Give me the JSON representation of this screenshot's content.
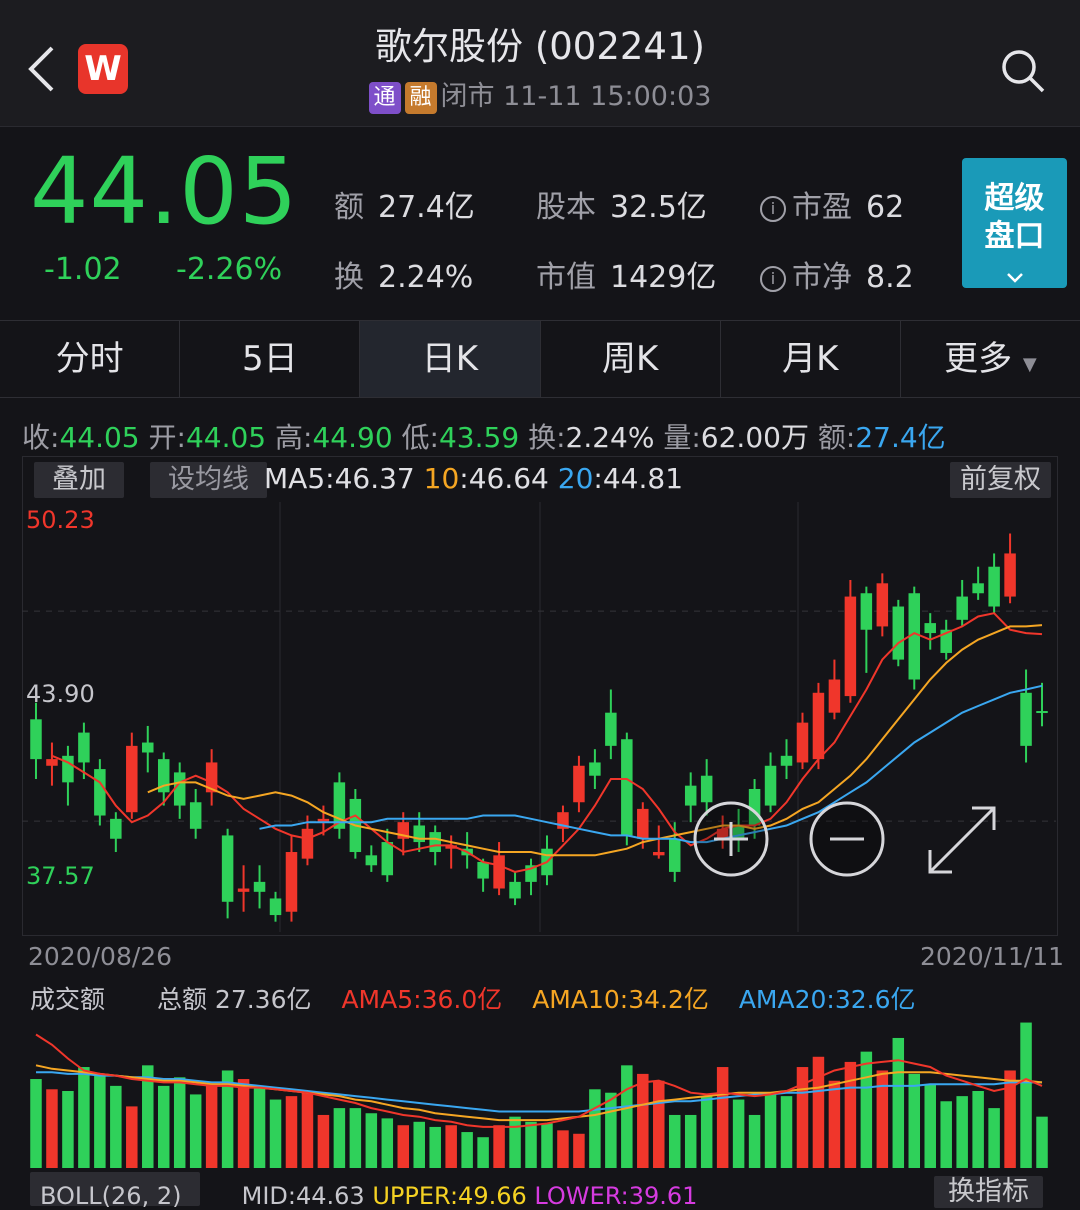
{
  "header": {
    "title": "歌尔股份 (002241)",
    "tag_tong": "通",
    "tag_rong": "融",
    "status": "闭市 11-11 15:00:03",
    "logo_letter": "W"
  },
  "quote": {
    "price": "44.05",
    "change": "-1.02",
    "change_pct": "-2.26%",
    "stats": [
      {
        "k": "额",
        "v": "27.4亿"
      },
      {
        "k": "股本",
        "v": "32.5亿"
      },
      {
        "k": "市盈",
        "v": "62"
      },
      {
        "k": "换",
        "v": "2.24%"
      },
      {
        "k": "市值",
        "v": "1429亿"
      },
      {
        "k": "市净",
        "v": "8.2"
      }
    ],
    "super_btn": [
      "超级",
      "盘口"
    ]
  },
  "tabs": [
    "分时",
    "5日",
    "日K",
    "周K",
    "月K",
    "更多"
  ],
  "ohlc": {
    "close_k": "收:",
    "close": "44.05",
    "open_k": "开:",
    "open": "44.05",
    "high_k": "高:",
    "high": "44.90",
    "low_k": "低:",
    "low": "43.59",
    "turn_k": "换:",
    "turn": "2.24%",
    "vol_k": "量:",
    "vol": "62.00万",
    "amt_k": "额:",
    "amt": "27.4亿"
  },
  "chart_controls": {
    "overlay": "叠加",
    "set_ma": "设均线",
    "adjust": "前复权",
    "ma5_k": "MA5",
    "ma5": ":46.37",
    "ma10_k": "10",
    "ma10": ":46.64",
    "ma20_k": "20",
    "ma20": ":44.81"
  },
  "axis": {
    "y_top": "50.23",
    "y_mid": "43.90",
    "y_low": "37.57",
    "date_start": "2020/08/26",
    "date_end": "2020/11/11"
  },
  "volume": {
    "label": "成交额",
    "total": "总额 27.36亿",
    "ama5_k": "AMA5",
    "ama5": ":36.0亿",
    "ama10_k": "AMA10",
    "ama10": ":34.2亿",
    "ama20_k": "AMA20",
    "ama20": ":32.6亿"
  },
  "indicator": {
    "boll": "BOLL(26, 2)",
    "mid": "MID:44.63",
    "upper": "UPPER:49.66",
    "lower": "LOWER:39.61",
    "switch": "换指标"
  },
  "colors": {
    "up": "#f0362b",
    "down": "#2fd15a",
    "ma5": "#f0362b",
    "ma10": "#f5a623",
    "ma20": "#3aa7f0",
    "accent": "#1a9ab8"
  },
  "chart_data": {
    "type": "candlestick",
    "xlim": [
      "2020/08/26",
      "2020/11/11"
    ],
    "ylim": [
      37.57,
      50.23
    ],
    "candles": [
      [
        43.8,
        42.6,
        44.3,
        42.0
      ],
      [
        42.4,
        42.6,
        43.1,
        41.8
      ],
      [
        42.7,
        41.9,
        43.0,
        41.2
      ],
      [
        43.4,
        42.5,
        43.7,
        42.0
      ],
      [
        42.3,
        40.9,
        42.6,
        40.6
      ],
      [
        40.8,
        40.2,
        41.0,
        39.8
      ],
      [
        41.0,
        43.0,
        43.4,
        40.8
      ],
      [
        43.1,
        42.8,
        43.6,
        42.2
      ],
      [
        42.6,
        41.6,
        42.8,
        41.2
      ],
      [
        42.2,
        41.2,
        42.5,
        40.8
      ],
      [
        41.3,
        40.5,
        41.7,
        40.2
      ],
      [
        41.6,
        42.5,
        42.9,
        41.2
      ],
      [
        40.3,
        38.3,
        40.5,
        37.8
      ],
      [
        38.6,
        38.7,
        39.4,
        38.0
      ],
      [
        38.9,
        38.6,
        39.4,
        38.1
      ],
      [
        38.4,
        37.9,
        38.6,
        37.7
      ],
      [
        38.0,
        39.8,
        40.3,
        37.7
      ],
      [
        39.6,
        40.5,
        40.9,
        39.4
      ],
      [
        40.7,
        40.8,
        41.2,
        40.3
      ],
      [
        41.9,
        40.5,
        42.2,
        40.2
      ],
      [
        41.4,
        39.8,
        41.7,
        39.6
      ],
      [
        39.7,
        39.4,
        40.0,
        39.2
      ],
      [
        40.1,
        39.1,
        40.5,
        38.9
      ],
      [
        40.2,
        40.7,
        41.0,
        39.7
      ],
      [
        40.6,
        40.1,
        41.0,
        39.8
      ],
      [
        40.4,
        39.8,
        40.6,
        39.4
      ],
      [
        39.9,
        40.0,
        40.3,
        39.3
      ],
      [
        39.9,
        39.7,
        40.4,
        39.3
      ],
      [
        39.5,
        39.0,
        39.6,
        38.6
      ],
      [
        38.7,
        39.7,
        40.1,
        38.5
      ],
      [
        38.9,
        38.4,
        39.2,
        38.2
      ],
      [
        39.4,
        38.9,
        39.6,
        38.5
      ],
      [
        39.9,
        39.1,
        40.3,
        38.8
      ],
      [
        40.5,
        41.0,
        41.2,
        40.1
      ],
      [
        41.3,
        42.4,
        42.7,
        41.0
      ],
      [
        42.5,
        42.1,
        42.9,
        41.7
      ],
      [
        44.0,
        43.0,
        44.7,
        42.6
      ],
      [
        43.2,
        40.3,
        43.4,
        40.0
      ],
      [
        40.2,
        41.1,
        41.3,
        39.9
      ],
      [
        39.7,
        39.8,
        40.6,
        39.6
      ],
      [
        40.2,
        39.2,
        40.7,
        38.9
      ],
      [
        41.8,
        41.2,
        42.2,
        40.7
      ],
      [
        42.1,
        41.3,
        42.6,
        40.9
      ],
      [
        40.2,
        40.5,
        40.9,
        39.9
      ],
      [
        40.6,
        40.2,
        41.1,
        39.8
      ],
      [
        41.7,
        40.6,
        42.0,
        40.2
      ],
      [
        42.4,
        41.2,
        42.8,
        41.0
      ],
      [
        42.7,
        42.4,
        43.2,
        42.0
      ],
      [
        42.5,
        43.7,
        44.0,
        42.3
      ],
      [
        42.6,
        44.6,
        44.9,
        42.3
      ],
      [
        44.0,
        45.0,
        45.6,
        43.8
      ],
      [
        44.5,
        47.5,
        48.0,
        44.3
      ],
      [
        47.6,
        46.5,
        47.8,
        45.2
      ],
      [
        46.6,
        47.9,
        48.2,
        46.3
      ],
      [
        47.2,
        45.6,
        47.4,
        45.4
      ],
      [
        47.6,
        45.0,
        47.8,
        44.7
      ],
      [
        46.7,
        46.4,
        47.0,
        45.9
      ],
      [
        46.5,
        45.8,
        46.8,
        45.6
      ],
      [
        47.5,
        46.8,
        48.0,
        46.6
      ],
      [
        47.9,
        47.6,
        48.4,
        47.4
      ],
      [
        48.4,
        47.2,
        48.8,
        47.0
      ],
      [
        47.5,
        48.8,
        49.4,
        47.3
      ],
      [
        44.6,
        43.0,
        45.3,
        42.5
      ],
      [
        44.05,
        44.05,
        44.9,
        43.59
      ]
    ],
    "ma5": [
      42.7,
      42.5,
      42.2,
      41.9,
      41.2,
      40.7,
      40.9,
      41.3,
      41.9,
      42.1,
      41.9,
      41.6,
      41.1,
      40.8,
      40.5,
      40.3,
      40.2,
      40.4,
      40.7,
      40.9,
      40.5,
      40.1,
      39.8,
      39.9,
      40.0,
      40.0,
      39.8,
      39.5,
      39.4,
      39.2,
      39.3,
      39.5,
      40.0,
      40.5,
      41.2,
      42.0,
      42.0,
      41.7,
      41.1,
      40.4,
      40.0,
      40.2,
      40.5,
      40.6,
      40.6,
      40.8,
      41.3,
      42.0,
      42.6,
      43.1,
      43.9,
      44.7,
      45.6,
      46.1,
      46.4,
      46.2,
      46.4,
      46.6,
      46.9,
      47.0,
      46.5,
      46.4,
      46.37
    ],
    "ma10": [
      41.6,
      41.8,
      41.9,
      41.9,
      41.7,
      41.5,
      41.4,
      41.5,
      41.6,
      41.5,
      41.3,
      41.0,
      40.8,
      40.6,
      40.5,
      40.4,
      40.3,
      40.2,
      40.2,
      40.1,
      40.0,
      39.9,
      39.8,
      39.8,
      39.8,
      39.7,
      39.7,
      39.7,
      39.7,
      39.8,
      39.9,
      40.1,
      40.2,
      40.3,
      40.4,
      40.5,
      40.6,
      40.6,
      40.5,
      40.6,
      40.8,
      41.1,
      41.3,
      41.7,
      42.1,
      42.6,
      43.2,
      43.8,
      44.4,
      45.0,
      45.5,
      45.9,
      46.2,
      46.4,
      46.6,
      46.6,
      46.64
    ],
    "ma20": [
      40.5,
      40.6,
      40.6,
      40.7,
      40.7,
      40.7,
      40.7,
      40.7,
      40.8,
      40.8,
      40.8,
      40.8,
      40.8,
      40.8,
      40.9,
      40.9,
      40.9,
      40.8,
      40.7,
      40.6,
      40.5,
      40.4,
      40.3,
      40.3,
      40.2,
      40.2,
      40.2,
      40.1,
      40.1,
      40.2,
      40.3,
      40.4,
      40.5,
      40.6,
      40.8,
      41.0,
      41.3,
      41.6,
      41.9,
      42.3,
      42.7,
      43.1,
      43.4,
      43.7,
      44.0,
      44.2,
      44.4,
      44.6,
      44.7,
      44.81
    ],
    "volume": [
      52,
      46,
      45,
      59,
      55,
      48,
      36,
      60,
      48,
      53,
      43,
      48,
      57,
      52,
      48,
      40,
      42,
      44,
      31,
      35,
      35,
      32,
      29,
      25,
      27,
      24,
      25,
      21,
      18,
      25,
      30,
      27,
      26,
      22,
      20,
      46,
      44,
      60,
      55,
      51,
      31,
      31,
      42,
      59,
      40,
      31,
      43,
      42,
      59,
      65,
      51,
      62,
      68,
      57,
      76,
      55,
      49,
      39,
      42,
      45,
      35,
      57,
      85,
      30
    ],
    "ama5": [
      78,
      72,
      64,
      57,
      55,
      54,
      52,
      51,
      50,
      50,
      49,
      48,
      48,
      47,
      47,
      46,
      45,
      44,
      42,
      40,
      38,
      35,
      33,
      31,
      30,
      28,
      27,
      25,
      24,
      24,
      24,
      25,
      26,
      28,
      30,
      35,
      40,
      46,
      50,
      51,
      48,
      44,
      43,
      44,
      43,
      42,
      43,
      45,
      49,
      53,
      57,
      59,
      61,
      62,
      63,
      61,
      59,
      54,
      51,
      48,
      45,
      47,
      52,
      48
    ],
    "ama10": [
      60,
      58,
      57,
      56,
      55,
      54,
      53,
      52,
      51,
      51,
      50,
      49,
      49,
      48,
      47,
      46,
      45,
      44,
      43,
      42,
      40,
      39,
      37,
      35,
      34,
      32,
      31,
      30,
      29,
      28,
      28,
      28,
      28,
      29,
      30,
      31,
      33,
      35,
      37,
      39,
      40,
      41,
      42,
      43,
      44,
      44,
      44,
      45,
      46,
      47,
      49,
      51,
      53,
      55,
      56,
      56,
      56,
      55,
      54,
      53,
      52,
      51,
      51,
      50
    ],
    "ama20": [
      56,
      56,
      55,
      55,
      54,
      54,
      53,
      53,
      52,
      52,
      51,
      50,
      50,
      49,
      48,
      47,
      46,
      45,
      44,
      43,
      42,
      41,
      40,
      39,
      38,
      37,
      36,
      35,
      34,
      33,
      33,
      33,
      33,
      33,
      33,
      34,
      35,
      36,
      37,
      38,
      39,
      39,
      40,
      41,
      42,
      43,
      43,
      44,
      44,
      45,
      46,
      47,
      47,
      48,
      48,
      48,
      49,
      49,
      49,
      49,
      49,
      50,
      50,
      50
    ]
  }
}
